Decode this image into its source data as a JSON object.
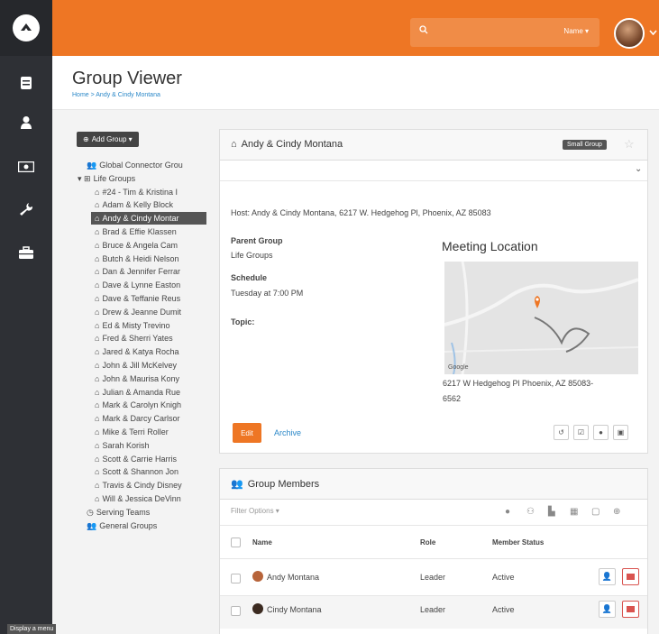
{
  "header": {
    "search_option": "Name ▾"
  },
  "page": {
    "title": "Group Viewer",
    "breadcrumb": "Home > Andy & Cindy Montana"
  },
  "tree": {
    "add_group_label": "Add Group ▾",
    "items": [
      {
        "icon": "users-icon",
        "label": "Global Connector Grou"
      },
      {
        "icon": "sitemap-icon",
        "label": "Life Groups"
      },
      {
        "icon": "home-icon",
        "label": "#24 - Tim & Kristina I"
      },
      {
        "icon": "home-icon",
        "label": "Adam & Kelly Block"
      },
      {
        "icon": "home-icon",
        "label": "Andy & Cindy Montar"
      },
      {
        "icon": "home-icon",
        "label": "Brad & Effie Klassen"
      },
      {
        "icon": "home-icon",
        "label": "Bruce & Angela Cam"
      },
      {
        "icon": "home-icon",
        "label": "Butch & Heidi Nelson"
      },
      {
        "icon": "home-icon",
        "label": "Dan & Jennifer Ferrar"
      },
      {
        "icon": "home-icon",
        "label": "Dave & Lynne Easton"
      },
      {
        "icon": "home-icon",
        "label": "Dave & Teffanie Reus"
      },
      {
        "icon": "home-icon",
        "label": "Drew & Jeanne Dumit"
      },
      {
        "icon": "home-icon",
        "label": "Ed & Misty Trevino"
      },
      {
        "icon": "home-icon",
        "label": "Fred & Sherri Yates"
      },
      {
        "icon": "home-icon",
        "label": "Jared & Katya Rocha"
      },
      {
        "icon": "home-icon",
        "label": "John & Jill McKelvey"
      },
      {
        "icon": "home-icon",
        "label": "John & Maurisa Kony"
      },
      {
        "icon": "home-icon",
        "label": "Julian & Amanda Rue"
      },
      {
        "icon": "home-icon",
        "label": "Mark & Carolyn Knigh"
      },
      {
        "icon": "home-icon",
        "label": "Mark & Darcy Carlsor"
      },
      {
        "icon": "home-icon",
        "label": "Mike & Terri Roller"
      },
      {
        "icon": "home-icon",
        "label": "Sarah Korish"
      },
      {
        "icon": "home-icon",
        "label": "Scott & Carrie Harris"
      },
      {
        "icon": "home-icon",
        "label": "Scott & Shannon Jon"
      },
      {
        "icon": "home-icon",
        "label": "Travis & Cindy Disney"
      },
      {
        "icon": "home-icon",
        "label": "Will & Jessica DeVinn"
      },
      {
        "icon": "clock-icon",
        "label": "Serving Teams"
      },
      {
        "icon": "users-icon",
        "label": "General Groups"
      }
    ]
  },
  "group": {
    "title": "Andy & Cindy Montana",
    "badge": "Small Group",
    "host": "Host: Andy & Cindy Montana, 6217 W. Hedgehog Pl, Phoenix, AZ 85083",
    "parent_label": "Parent Group",
    "parent_value": "Life Groups",
    "schedule_label": "Schedule",
    "schedule_value": "Tuesday at 7:00 PM",
    "topic_label": "Topic:",
    "meeting_title": "Meeting Location",
    "address_line1": "6217 W Hedgehog Pl Phoenix, AZ 85083-",
    "address_line2": "6562",
    "edit": "Edit",
    "archive": "Archive"
  },
  "members": {
    "title": "Group Members",
    "filter": "Filter Options ▾",
    "columns": [
      "Name",
      "Role",
      "Member Status"
    ],
    "rows": [
      {
        "name": "Andy Montana",
        "role": "Leader",
        "status": "Active"
      },
      {
        "name": "Cindy Montana",
        "role": "Leader",
        "status": "Active"
      }
    ]
  },
  "tooltip": "Display a menu",
  "colors": {
    "accent": "#ee7624",
    "sidebar": "#2e3035",
    "link": "#2b88c8",
    "danger": "#d9534f"
  }
}
